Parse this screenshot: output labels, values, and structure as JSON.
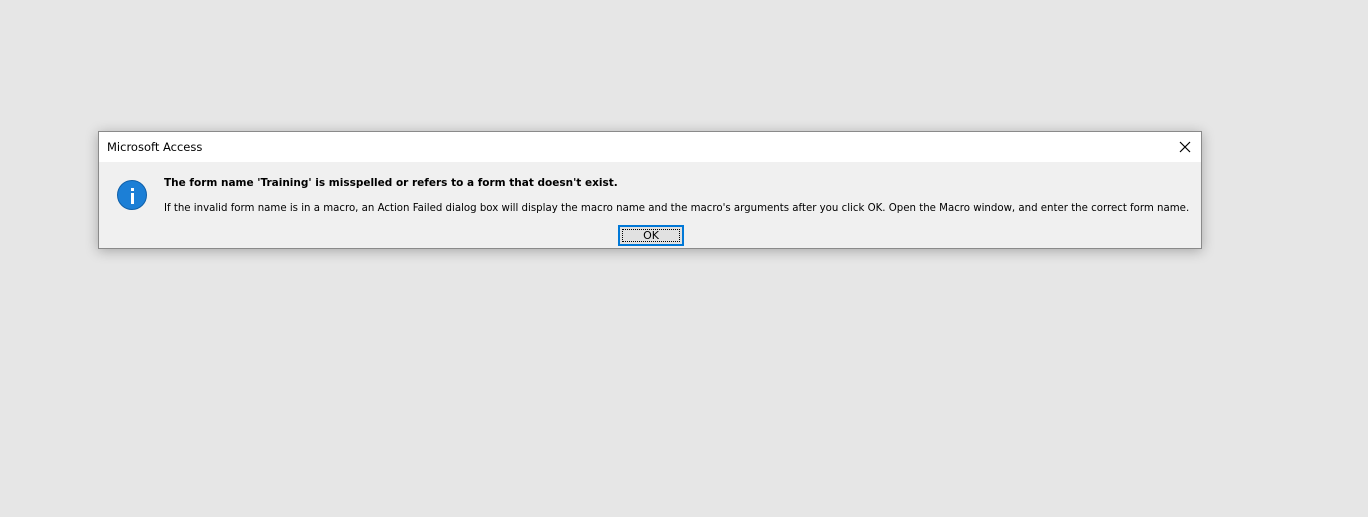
{
  "dialog": {
    "title": "Microsoft Access",
    "close_icon": "close-icon",
    "icon": "info-icon",
    "message_bold": "The form name 'Training' is misspelled or refers to a form that doesn't exist.",
    "message_detail": "If the invalid form name is in a macro, an Action Failed dialog box will display the macro name and the macro's arguments after you click OK. Open the Macro window, and enter the correct form name.",
    "ok_label": "OK"
  },
  "colors": {
    "desktop_background": "#e6e6e6",
    "dialog_background": "#f0f0f0",
    "titlebar_background": "#ffffff",
    "info_icon_blue": "#1c7fd6",
    "focus_border": "#0078d7"
  }
}
